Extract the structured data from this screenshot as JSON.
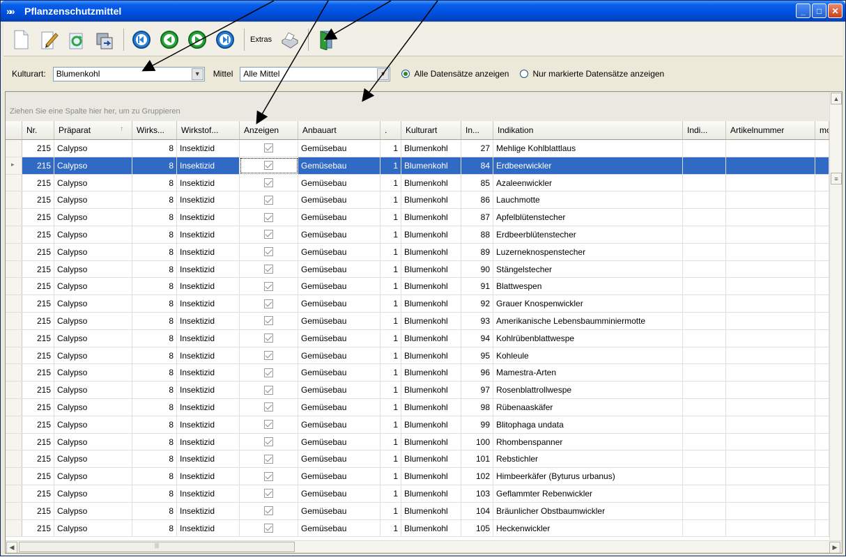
{
  "window": {
    "title": "Pflanzenschutzmittel"
  },
  "toolbar": {
    "buttons": [
      "new-icon",
      "edit-icon",
      "refresh-icon",
      "copy-icon",
      "first-record-icon",
      "previous-record-icon",
      "next-record-icon",
      "last-record-icon",
      "print-icon",
      "exit-icon"
    ],
    "extras_label": "Extras"
  },
  "filter": {
    "kulturart_label": "Kulturart:",
    "kulturart_value": "Blumenkohl",
    "mittel_label": "Mittel",
    "mittel_value": "Alle Mittel",
    "radio_all": "Alle Datensätze anzeigen",
    "radio_marked": "Nur markierte Datensätze anzeigen",
    "selected_radio": "all"
  },
  "grid": {
    "group_hint": "Ziehen Sie eine Spalte hier her, um zu Gruppieren",
    "columns": [
      "Nr.",
      "Präparat",
      "Wirks...",
      "Wirkstof...",
      "Anzeigen",
      "Anbauart",
      ".",
      "Kulturart",
      "In...",
      "Indikation",
      "Indi...",
      "Artikelnummer",
      "mo"
    ],
    "sort_indicator": "↑",
    "rows": [
      {
        "nr": "215",
        "praeparat": "Calypso",
        "wirks": "8",
        "wirkstoff": "Insektizid",
        "anbauart": "Gemüsebau",
        "dot": "1",
        "kulturart": "Blumenkohl",
        "in": "27",
        "indikation": "Mehlige Kohlblattlaus"
      },
      {
        "nr": "215",
        "praeparat": "Calypso",
        "wirks": "8",
        "wirkstoff": "Insektizid",
        "anbauart": "Gemüsebau",
        "dot": "1",
        "kulturart": "Blumenkohl",
        "in": "84",
        "indikation": "Erdbeerwickler",
        "selected": true
      },
      {
        "nr": "215",
        "praeparat": "Calypso",
        "wirks": "8",
        "wirkstoff": "Insektizid",
        "anbauart": "Gemüsebau",
        "dot": "1",
        "kulturart": "Blumenkohl",
        "in": "85",
        "indikation": "Azaleenwickler"
      },
      {
        "nr": "215",
        "praeparat": "Calypso",
        "wirks": "8",
        "wirkstoff": "Insektizid",
        "anbauart": "Gemüsebau",
        "dot": "1",
        "kulturart": "Blumenkohl",
        "in": "86",
        "indikation": "Lauchmotte"
      },
      {
        "nr": "215",
        "praeparat": "Calypso",
        "wirks": "8",
        "wirkstoff": "Insektizid",
        "anbauart": "Gemüsebau",
        "dot": "1",
        "kulturart": "Blumenkohl",
        "in": "87",
        "indikation": "Apfelblütenstecher"
      },
      {
        "nr": "215",
        "praeparat": "Calypso",
        "wirks": "8",
        "wirkstoff": "Insektizid",
        "anbauart": "Gemüsebau",
        "dot": "1",
        "kulturart": "Blumenkohl",
        "in": "88",
        "indikation": "Erdbeerblütenstecher"
      },
      {
        "nr": "215",
        "praeparat": "Calypso",
        "wirks": "8",
        "wirkstoff": "Insektizid",
        "anbauart": "Gemüsebau",
        "dot": "1",
        "kulturart": "Blumenkohl",
        "in": "89",
        "indikation": "Luzerneknospenstecher"
      },
      {
        "nr": "215",
        "praeparat": "Calypso",
        "wirks": "8",
        "wirkstoff": "Insektizid",
        "anbauart": "Gemüsebau",
        "dot": "1",
        "kulturart": "Blumenkohl",
        "in": "90",
        "indikation": "Stängelstecher"
      },
      {
        "nr": "215",
        "praeparat": "Calypso",
        "wirks": "8",
        "wirkstoff": "Insektizid",
        "anbauart": "Gemüsebau",
        "dot": "1",
        "kulturart": "Blumenkohl",
        "in": "91",
        "indikation": "Blattwespen"
      },
      {
        "nr": "215",
        "praeparat": "Calypso",
        "wirks": "8",
        "wirkstoff": "Insektizid",
        "anbauart": "Gemüsebau",
        "dot": "1",
        "kulturart": "Blumenkohl",
        "in": "92",
        "indikation": "Grauer Knospenwickler"
      },
      {
        "nr": "215",
        "praeparat": "Calypso",
        "wirks": "8",
        "wirkstoff": "Insektizid",
        "anbauart": "Gemüsebau",
        "dot": "1",
        "kulturart": "Blumenkohl",
        "in": "93",
        "indikation": "Amerikanische Lebensbaumminiermotte"
      },
      {
        "nr": "215",
        "praeparat": "Calypso",
        "wirks": "8",
        "wirkstoff": "Insektizid",
        "anbauart": "Gemüsebau",
        "dot": "1",
        "kulturart": "Blumenkohl",
        "in": "94",
        "indikation": "Kohlrübenblattwespe"
      },
      {
        "nr": "215",
        "praeparat": "Calypso",
        "wirks": "8",
        "wirkstoff": "Insektizid",
        "anbauart": "Gemüsebau",
        "dot": "1",
        "kulturart": "Blumenkohl",
        "in": "95",
        "indikation": "Kohleule"
      },
      {
        "nr": "215",
        "praeparat": "Calypso",
        "wirks": "8",
        "wirkstoff": "Insektizid",
        "anbauart": "Gemüsebau",
        "dot": "1",
        "kulturart": "Blumenkohl",
        "in": "96",
        "indikation": "Mamestra-Arten"
      },
      {
        "nr": "215",
        "praeparat": "Calypso",
        "wirks": "8",
        "wirkstoff": "Insektizid",
        "anbauart": "Gemüsebau",
        "dot": "1",
        "kulturart": "Blumenkohl",
        "in": "97",
        "indikation": "Rosenblattrollwespe"
      },
      {
        "nr": "215",
        "praeparat": "Calypso",
        "wirks": "8",
        "wirkstoff": "Insektizid",
        "anbauart": "Gemüsebau",
        "dot": "1",
        "kulturart": "Blumenkohl",
        "in": "98",
        "indikation": "Rübenaaskäfer"
      },
      {
        "nr": "215",
        "praeparat": "Calypso",
        "wirks": "8",
        "wirkstoff": "Insektizid",
        "anbauart": "Gemüsebau",
        "dot": "1",
        "kulturart": "Blumenkohl",
        "in": "99",
        "indikation": "Blitophaga undata"
      },
      {
        "nr": "215",
        "praeparat": "Calypso",
        "wirks": "8",
        "wirkstoff": "Insektizid",
        "anbauart": "Gemüsebau",
        "dot": "1",
        "kulturart": "Blumenkohl",
        "in": "100",
        "indikation": "Rhombenspanner"
      },
      {
        "nr": "215",
        "praeparat": "Calypso",
        "wirks": "8",
        "wirkstoff": "Insektizid",
        "anbauart": "Gemüsebau",
        "dot": "1",
        "kulturart": "Blumenkohl",
        "in": "101",
        "indikation": "Rebstichler"
      },
      {
        "nr": "215",
        "praeparat": "Calypso",
        "wirks": "8",
        "wirkstoff": "Insektizid",
        "anbauart": "Gemüsebau",
        "dot": "1",
        "kulturart": "Blumenkohl",
        "in": "102",
        "indikation": "Himbeerkäfer (Byturus urbanus)"
      },
      {
        "nr": "215",
        "praeparat": "Calypso",
        "wirks": "8",
        "wirkstoff": "Insektizid",
        "anbauart": "Gemüsebau",
        "dot": "1",
        "kulturart": "Blumenkohl",
        "in": "103",
        "indikation": "Geflammter Rebenwickler"
      },
      {
        "nr": "215",
        "praeparat": "Calypso",
        "wirks": "8",
        "wirkstoff": "Insektizid",
        "anbauart": "Gemüsebau",
        "dot": "1",
        "kulturart": "Blumenkohl",
        "in": "104",
        "indikation": "Bräunlicher Obstbaumwickler"
      },
      {
        "nr": "215",
        "praeparat": "Calypso",
        "wirks": "8",
        "wirkstoff": "Insektizid",
        "anbauart": "Gemüsebau",
        "dot": "1",
        "kulturart": "Blumenkohl",
        "in": "105",
        "indikation": "Heckenwickler"
      }
    ]
  },
  "colors": {
    "titlebar": "#0054e3",
    "selection": "#316ac5"
  }
}
